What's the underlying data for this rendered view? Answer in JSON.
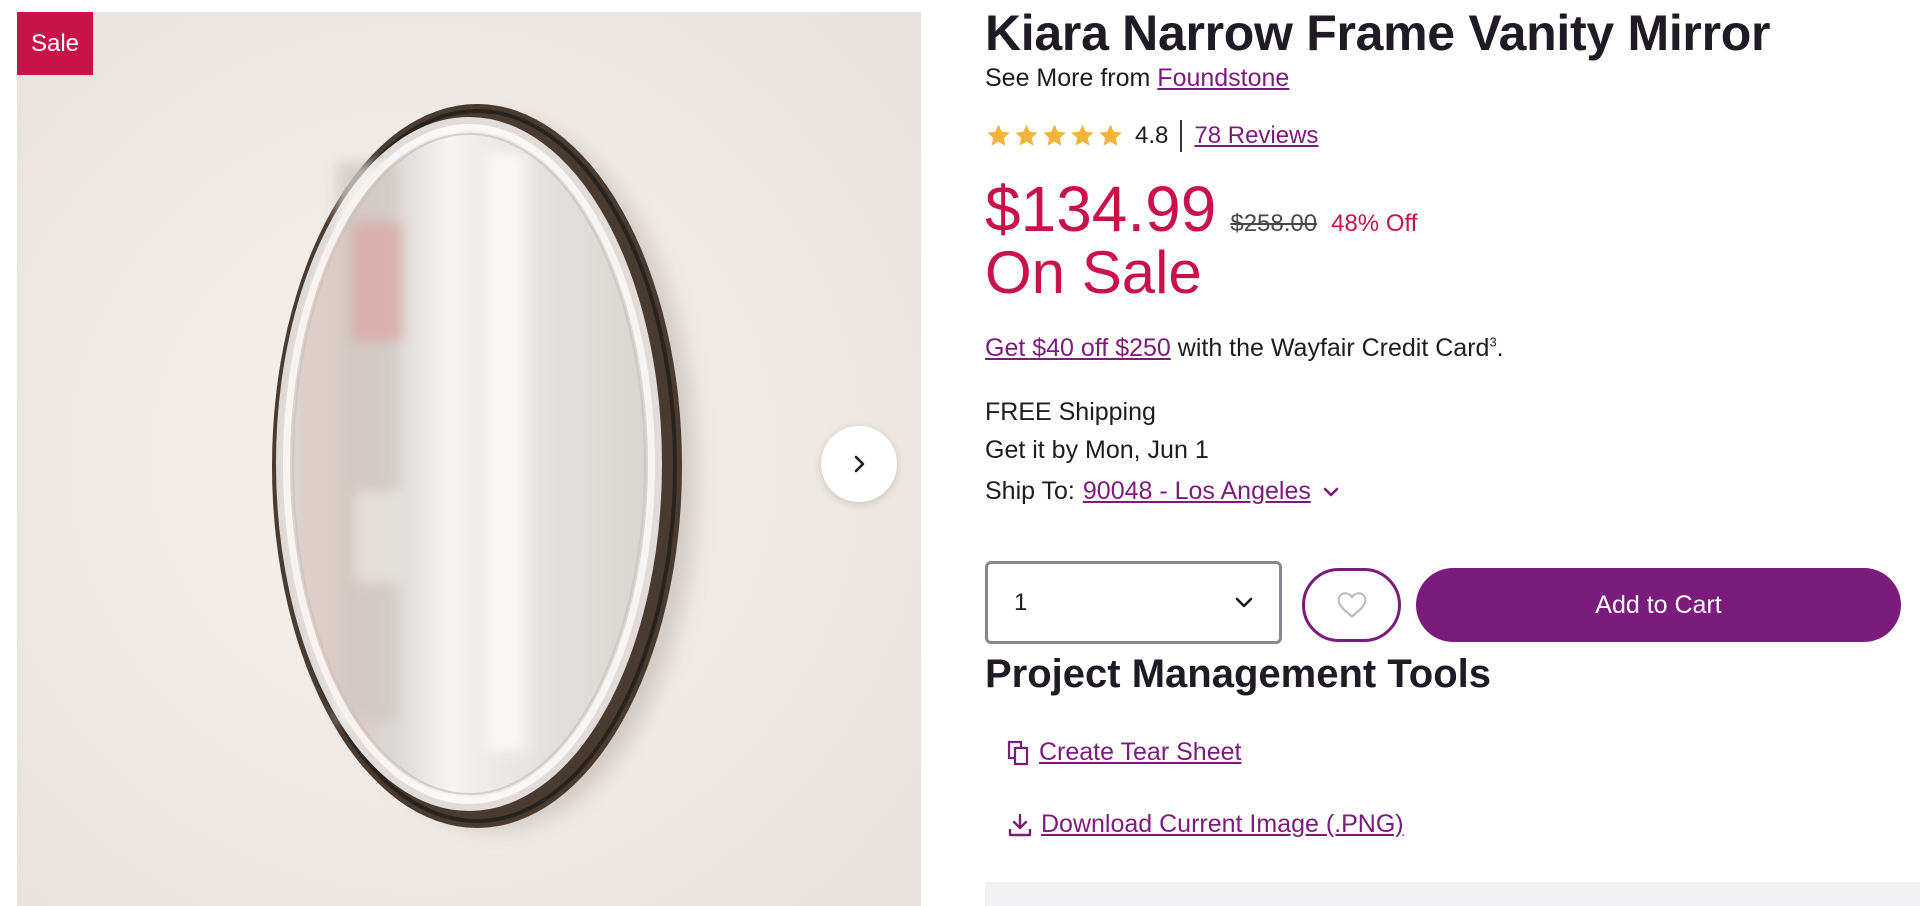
{
  "gallery": {
    "badge": "Sale",
    "next_icon": "chevron-right-icon",
    "image_subject": "oval-mirror-icon"
  },
  "product": {
    "title": "Kiara Narrow Frame Vanity Mirror",
    "brand_prefix": "See More from",
    "brand_name": "Foundstone",
    "rating": "4.8",
    "rating_fraction": 0.96,
    "reviews": "78 Reviews",
    "price": "$134.99",
    "original_price": "$258.00",
    "discount": "48% Off",
    "sale_label": "On Sale",
    "credit_offer": "Get $40 off $250",
    "credit_text": "with the Wayfair Credit Card",
    "credit_sup": "3",
    "credit_end": ".",
    "shipping": "FREE Shipping",
    "delivery": "Get it by Mon, Jun 1",
    "ship_to_label": "Ship To:",
    "ship_to_location": "90048 - Los Angeles"
  },
  "purchase": {
    "quantity": "1",
    "add_to_cart": "Add to Cart"
  },
  "project_tools": {
    "title": "Project Management Tools",
    "tear_sheet": "Create Tear Sheet",
    "download": "Download Current Image (.PNG)"
  },
  "colors": {
    "accent": "#7b1b7b",
    "sale": "#c8134a",
    "star": "#f3b43b",
    "text": "#1f1a24"
  }
}
